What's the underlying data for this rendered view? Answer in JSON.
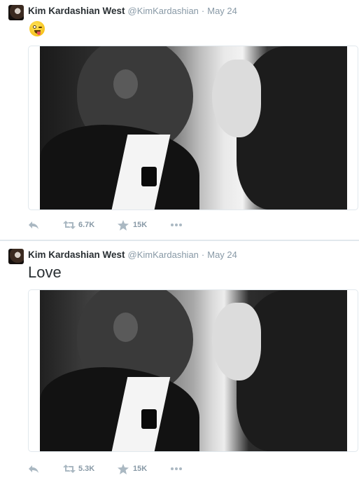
{
  "tweets": [
    {
      "fullname": "Kim Kardashian West",
      "username": "@KimKardashian",
      "separator": "·",
      "time": "May 24",
      "emoji_icon": "winking-face-with-tongue-emoji",
      "retweets": "6.7K",
      "favorites": "15K"
    },
    {
      "fullname": "Kim Kardashian West",
      "username": "@KimKardashian",
      "separator": "·",
      "time": "May 24",
      "text": "Love",
      "retweets": "5.3K",
      "favorites": "15K"
    }
  ],
  "icons": {
    "reply": "reply-icon",
    "retweet": "retweet-icon",
    "favorite": "star-icon",
    "more": "more-icon"
  },
  "colors": {
    "name": "#292f33",
    "meta": "#8899a6",
    "icon": "#aab8c2",
    "border": "#e1e8ed"
  }
}
